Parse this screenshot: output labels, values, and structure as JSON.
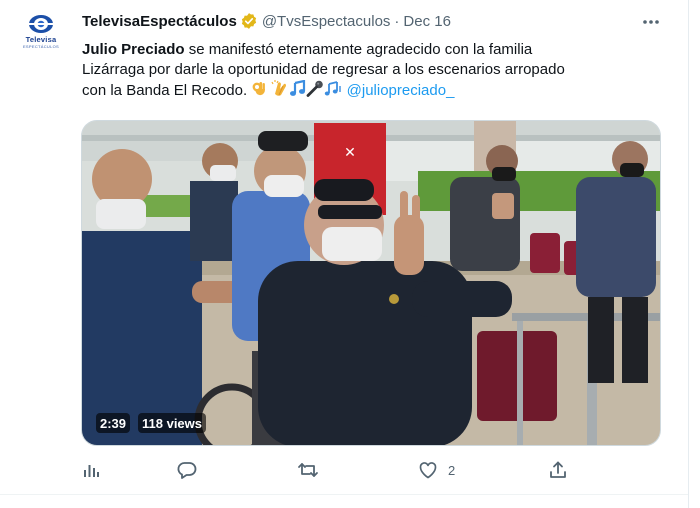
{
  "tweet": {
    "author_name": "TelevisaEspectáculos",
    "handle": "@TvsEspectaculos",
    "separator": "·",
    "date": "Dec 16",
    "avatar": {
      "brand": "Televisa",
      "brand_sub": "ESPECTÁCULOS"
    },
    "verified_color": "#e2b719",
    "text": {
      "bold_name": "Julio Preciado",
      "line1": " se manifestó eternamente agradecido con la familia",
      "line2": "Lizárraga por darle la oportunidad de regresar a los escenarios arropado",
      "line3": "con la Banda El Recodo.",
      "emojis": [
        "ok-hand",
        "clapping-hands",
        "musical-note",
        "microphone",
        "musical-notes"
      ],
      "mention": "@juliopreciado_"
    },
    "video": {
      "duration": "2:39",
      "views": "118 views"
    },
    "actions": {
      "analytics_icon": "bar-chart-icon",
      "reply_icon": "speech-bubble-icon",
      "retweet_icon": "retweet-arrows-icon",
      "like_icon": "heart-icon",
      "like_count": "2",
      "share_icon": "share-upload-icon"
    }
  },
  "colors": {
    "link": "#1d9bf0",
    "secondary_text": "#536471",
    "primary_text": "#0f1419"
  }
}
